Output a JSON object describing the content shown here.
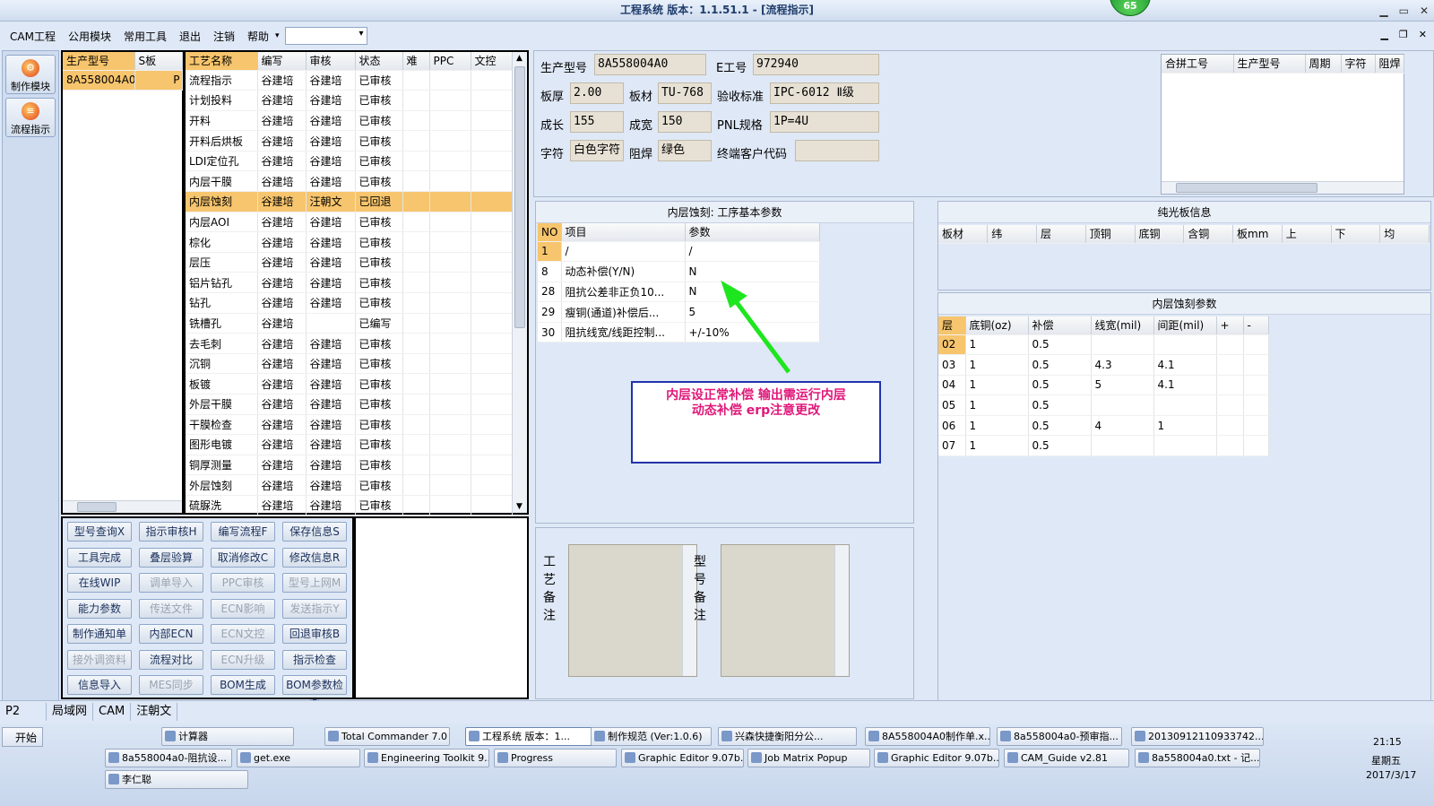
{
  "title": "工程系统   版本：1.1.51.1 - [流程指示]",
  "badge": "65",
  "menu": {
    "items": [
      "CAM工程",
      "公用模块",
      "常用工具",
      "退出",
      "注销",
      "帮助"
    ]
  },
  "nav": [
    {
      "label": "制作模块",
      "icon": "gear-icon"
    },
    {
      "label": "流程指示",
      "icon": "flow-icon"
    }
  ],
  "model_list": {
    "headers": [
      "生产型号",
      "S板"
    ],
    "rows": [
      [
        "8A558004A0",
        "P"
      ]
    ]
  },
  "process": {
    "headers": [
      "工艺名称",
      "编写",
      "审核",
      "状态",
      "难",
      "PPC",
      "文控"
    ],
    "rows": [
      [
        "流程指示",
        "谷建培",
        "谷建培",
        "已审核"
      ],
      [
        "计划投料",
        "谷建培",
        "谷建培",
        "已审核"
      ],
      [
        "开料",
        "谷建培",
        "谷建培",
        "已审核"
      ],
      [
        "开料后烘板",
        "谷建培",
        "谷建培",
        "已审核"
      ],
      [
        "LDI定位孔",
        "谷建培",
        "谷建培",
        "已审核"
      ],
      [
        "内层干膜",
        "谷建培",
        "谷建培",
        "已审核"
      ],
      [
        "内层蚀刻",
        "谷建培",
        "汪朝文",
        "已回退"
      ],
      [
        "内层AOI",
        "谷建培",
        "谷建培",
        "已审核"
      ],
      [
        "棕化",
        "谷建培",
        "谷建培",
        "已审核"
      ],
      [
        "层压",
        "谷建培",
        "谷建培",
        "已审核"
      ],
      [
        "铝片钻孔",
        "谷建培",
        "谷建培",
        "已审核"
      ],
      [
        "钻孔",
        "谷建培",
        "谷建培",
        "已审核"
      ],
      [
        "铣槽孔",
        "谷建培",
        "",
        "已编写"
      ],
      [
        "去毛刺",
        "谷建培",
        "谷建培",
        "已审核"
      ],
      [
        "沉铜",
        "谷建培",
        "谷建培",
        "已审核"
      ],
      [
        "板镀",
        "谷建培",
        "谷建培",
        "已审核"
      ],
      [
        "外层干膜",
        "谷建培",
        "谷建培",
        "已审核"
      ],
      [
        "干膜检查",
        "谷建培",
        "谷建培",
        "已审核"
      ],
      [
        "图形电镀",
        "谷建培",
        "谷建培",
        "已审核"
      ],
      [
        "铜厚测量",
        "谷建培",
        "谷建培",
        "已审核"
      ],
      [
        "外层蚀刻",
        "谷建培",
        "谷建培",
        "已审核"
      ],
      [
        "硫脲洗",
        "谷建培",
        "谷建培",
        "已审核"
      ]
    ]
  },
  "buttons": [
    [
      "型号查询X",
      "指示审核H",
      "编写流程F",
      "保存信息S"
    ],
    [
      "工具完成",
      "叠层验算",
      "取消修改C",
      "修改信息R"
    ],
    [
      "在线WIP",
      "调单导入",
      "PPC审核",
      "型号上网M"
    ],
    [
      "能力参数",
      "传送文件",
      "ECN影响",
      "发送指示Y"
    ],
    [
      "制作通知单",
      "内部ECN",
      "ECN文控",
      "回退审核B"
    ],
    [
      "接外调资料",
      "流程对比",
      "ECN升级",
      "指示检查"
    ],
    [
      "信息导入",
      "MES同步",
      "BOM生成",
      "BOM参数检查"
    ]
  ],
  "buttons_disabled": [
    [
      "型号查询X",
      false
    ],
    [
      "调单导入",
      true
    ],
    [
      "PPC审核",
      true
    ],
    [
      "型号上网M",
      true
    ],
    [
      "传送文件",
      true
    ],
    [
      "ECN影响",
      true
    ],
    [
      "发送指示Y",
      true
    ],
    [
      "ECN文控",
      true
    ],
    [
      "接外调资料",
      true
    ],
    [
      "ECN升级",
      true
    ],
    [
      "MES同步",
      true
    ]
  ],
  "info": {
    "prod_model_label": "生产型号",
    "prod_model": "8A558004A0",
    "e_no_label": "E工号",
    "e_no": "972940",
    "thick_label": "板厚",
    "thick": "2.00",
    "mat_label": "板材",
    "mat": "TU-768",
    "std_label": "验收标准",
    "std": "IPC-6012 Ⅱ级",
    "len_label": "成长",
    "len": "155",
    "wid_label": "成宽",
    "wid": "150",
    "pnl_label": "PNL规格",
    "pnl": "1P=4U",
    "char_label": "字符",
    "char": "白色字符",
    "solder_label": "阻焊",
    "solder": "绿色",
    "cust_label": "终端客户代码",
    "cust": ""
  },
  "combine": {
    "headers": [
      "合拼工号",
      "生产型号",
      "周期",
      "字符",
      "阻焊"
    ]
  },
  "params": {
    "title": "内层蚀刻: 工序基本参数",
    "headers": [
      "NO",
      "项目",
      "参数"
    ],
    "rows": [
      [
        "1",
        "/",
        "/"
      ],
      [
        "8",
        "动态补偿(Y/N)",
        "N"
      ],
      [
        "28",
        "阻抗公差非正负10...",
        "N"
      ],
      [
        "29",
        "瘦铜(通道)补偿后...",
        "5"
      ],
      [
        "30",
        "阻抗线宽/线距控制...",
        "+/-10%"
      ]
    ]
  },
  "annotation": {
    "line1": "内层设正常补偿   输出需运行内层",
    "line2": "动态补偿   erp注意更改"
  },
  "bare": {
    "title": "纯光板信息",
    "headers": [
      "板材",
      "纬",
      "层",
      "顶铜",
      "底铜",
      "含铜",
      "板mm",
      "上",
      "下",
      "均"
    ]
  },
  "etch": {
    "title": "内层蚀刻参数",
    "headers": [
      "层",
      "底铜(oz)",
      "补偿",
      "线宽(mil)",
      "间距(mil)",
      "+",
      "-"
    ],
    "rows": [
      [
        "02",
        "1",
        "0.5",
        "",
        "",
        "",
        ""
      ],
      [
        "03",
        "1",
        "0.5",
        "4.3",
        "4.1",
        "",
        ""
      ],
      [
        "04",
        "1",
        "0.5",
        "5",
        "4.1",
        "",
        ""
      ],
      [
        "05",
        "1",
        "0.5",
        "",
        "",
        "",
        ""
      ],
      [
        "06",
        "1",
        "0.5",
        "4",
        "1",
        "",
        ""
      ],
      [
        "07",
        "1",
        "0.5",
        "",
        "",
        "",
        ""
      ]
    ]
  },
  "notes": {
    "process_label": "工艺备注",
    "model_label": "型号备注"
  },
  "status": {
    "items": [
      "P2",
      "局域网",
      "CAM",
      "汪朝文"
    ]
  },
  "taskbar": {
    "start": "开始",
    "row1": [
      "计算器",
      "Total Commander 7.0 ...",
      "工程系统   版本：1...",
      "制作规范 (Ver:1.0.6)",
      "兴森快捷衡阳分公...",
      "8A558004A0制作单.x...",
      "8a558004a0-预审指...",
      "20130912110933742...."
    ],
    "row2": [
      "8a558004a0-阻抗设...",
      "get.exe",
      "Engineering Toolkit 9....",
      "Progress",
      "Graphic Editor 9.07b...",
      "Job Matrix Popup",
      "Graphic Editor 9.07b...",
      "CAM_Guide v2.81",
      "8a558004a0.txt - 记..."
    ],
    "row3": [
      "李仁聪"
    ],
    "time": "21:15",
    "weekday": "星期五",
    "date": "2017/3/17"
  }
}
